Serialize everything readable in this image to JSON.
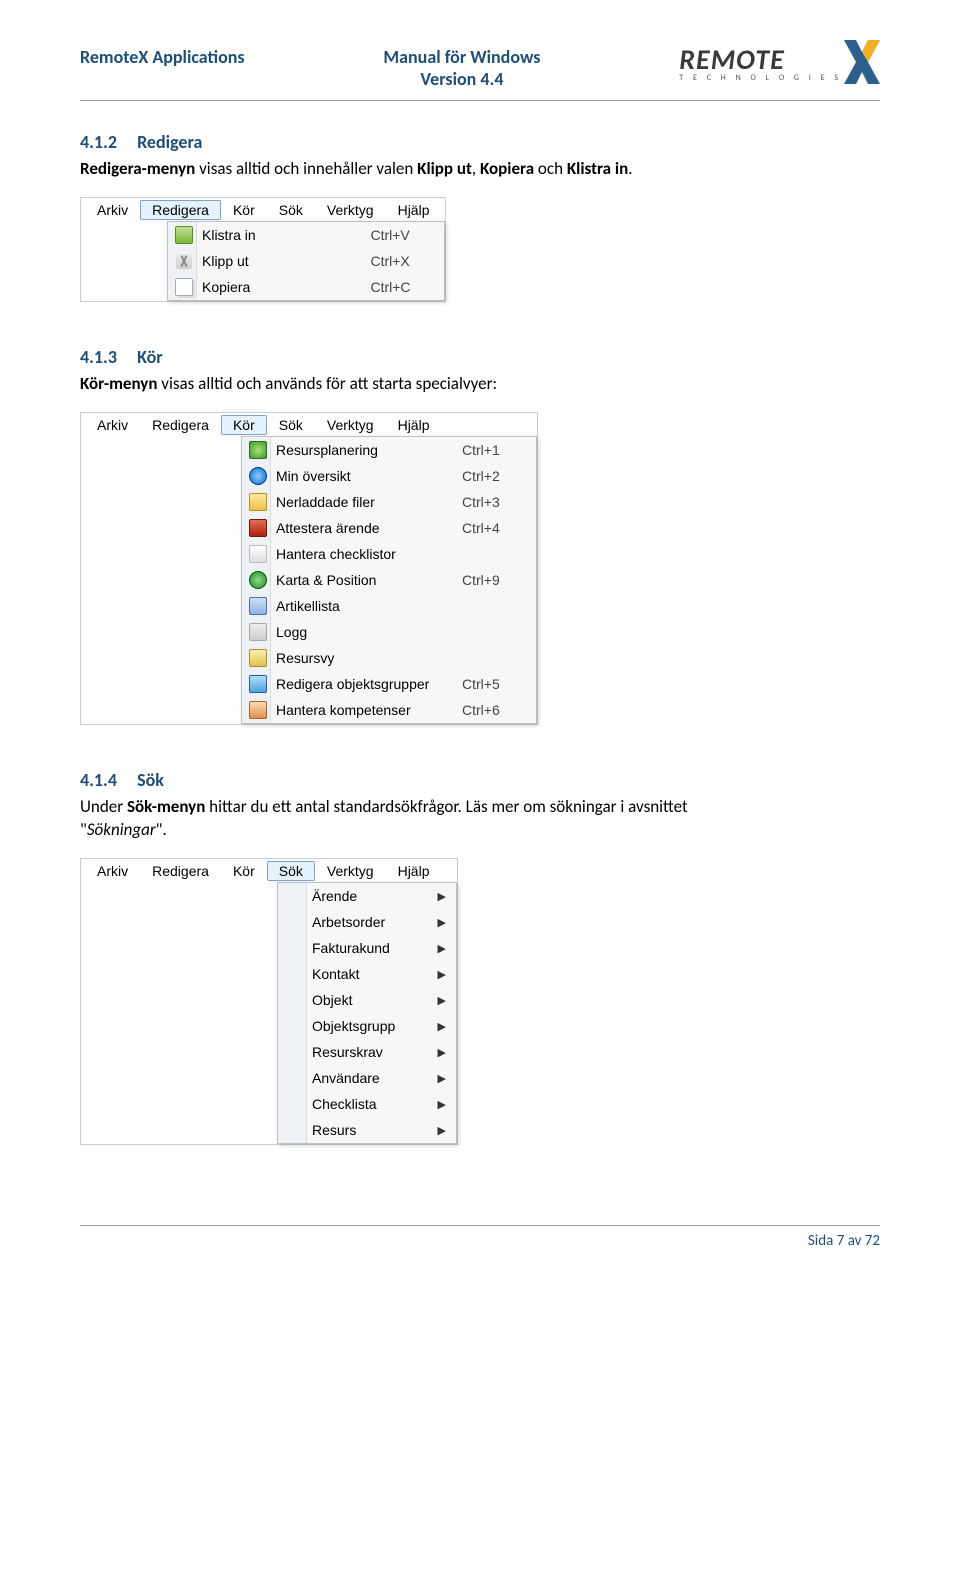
{
  "header": {
    "left": "RemoteX Applications",
    "center_line1": "Manual för Windows",
    "center_line2": "Version 4.4",
    "logo_main": "REMOTE",
    "logo_sub": "T E C H N O L O G I E S"
  },
  "sections": {
    "s1": {
      "num": "4.1.2",
      "title": "Redigera",
      "body_before": "Redigera-menyn",
      "body_mid1": " visas alltid och innehåller valen ",
      "b1": "Klipp ut",
      "sep1": ", ",
      "b2": "Kopiera",
      "mid2": " och ",
      "b3": "Klistra in",
      "end": "."
    },
    "s2": {
      "num": "4.1.3",
      "title": "Kör",
      "body_before": "Kör-menyn",
      "body_rest": " visas alltid och används för att starta specialvyer:"
    },
    "s3": {
      "num": "4.1.4",
      "title": "Sök",
      "p1a": "Under ",
      "p1b": "Sök-menyn",
      "p1c": " hittar du ett antal standardsökfrågor. Läs mer om sökningar i avsnittet ",
      "p2a": "\"",
      "p2b": "Sökningar",
      "p2c": "\"."
    }
  },
  "menubar_items": [
    "Arkiv",
    "Redigera",
    "Kör",
    "Sök",
    "Verktyg",
    "Hjälp"
  ],
  "menu_redigera": {
    "items": [
      {
        "icon": "ico-paste",
        "label": "Klistra in",
        "shortcut": "Ctrl+V"
      },
      {
        "icon": "ico-cut",
        "label": "Klipp ut",
        "shortcut": "Ctrl+X"
      },
      {
        "icon": "ico-copy",
        "label": "Kopiera",
        "shortcut": "Ctrl+C"
      }
    ]
  },
  "menu_kor": {
    "items": [
      {
        "icon": "ico-sched",
        "label": "Resursplanering",
        "shortcut": "Ctrl+1"
      },
      {
        "icon": "ico-globe",
        "label": "Min översikt",
        "shortcut": "Ctrl+2"
      },
      {
        "icon": "ico-download",
        "label": "Nerladdade filer",
        "shortcut": "Ctrl+3"
      },
      {
        "icon": "ico-book",
        "label": "Attestera ärende",
        "shortcut": "Ctrl+4"
      },
      {
        "icon": "ico-check",
        "label": "Hantera checklistor",
        "shortcut": ""
      },
      {
        "icon": "ico-map",
        "label": "Karta & Position",
        "shortcut": "Ctrl+9"
      },
      {
        "icon": "ico-list",
        "label": "Artikellista",
        "shortcut": ""
      },
      {
        "icon": "ico-log",
        "label": "Logg",
        "shortcut": ""
      },
      {
        "icon": "ico-user",
        "label": "Resursvy",
        "shortcut": ""
      },
      {
        "icon": "ico-grid",
        "label": "Redigera objektsgrupper",
        "shortcut": "Ctrl+5"
      },
      {
        "icon": "ico-comp",
        "label": "Hantera kompetenser",
        "shortcut": "Ctrl+6"
      }
    ]
  },
  "menu_sok": {
    "items": [
      {
        "label": "Ärende"
      },
      {
        "label": "Arbetsorder"
      },
      {
        "label": "Fakturakund"
      },
      {
        "label": "Kontakt"
      },
      {
        "label": "Objekt"
      },
      {
        "label": "Objektsgrupp"
      },
      {
        "label": "Resurskrav"
      },
      {
        "label": "Användare"
      },
      {
        "label": "Checklista"
      },
      {
        "label": "Resurs"
      }
    ]
  },
  "footer": "Sida 7 av 72"
}
